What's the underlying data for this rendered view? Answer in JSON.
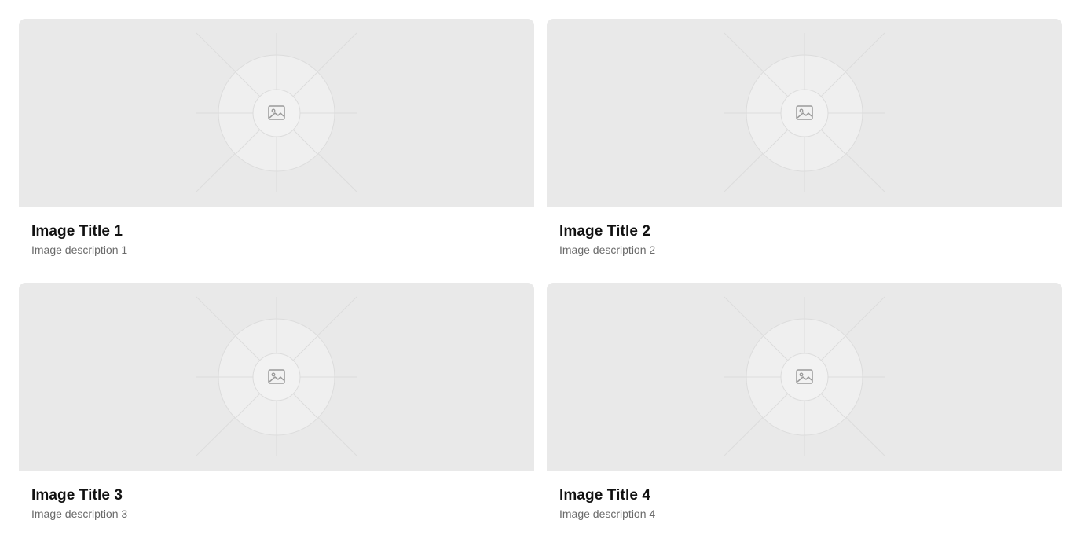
{
  "gallery": {
    "cards": [
      {
        "title": "Image Title 1",
        "description": "Image description 1"
      },
      {
        "title": "Image Title 2",
        "description": "Image description 2"
      },
      {
        "title": "Image Title 3",
        "description": "Image description 3"
      },
      {
        "title": "Image Title 4",
        "description": "Image description 4"
      }
    ]
  },
  "icons": {
    "placeholder": "image-icon"
  },
  "colors": {
    "placeholder_bg": "#e9e9e9",
    "title": "#111111",
    "description": "#6b6b6b"
  }
}
